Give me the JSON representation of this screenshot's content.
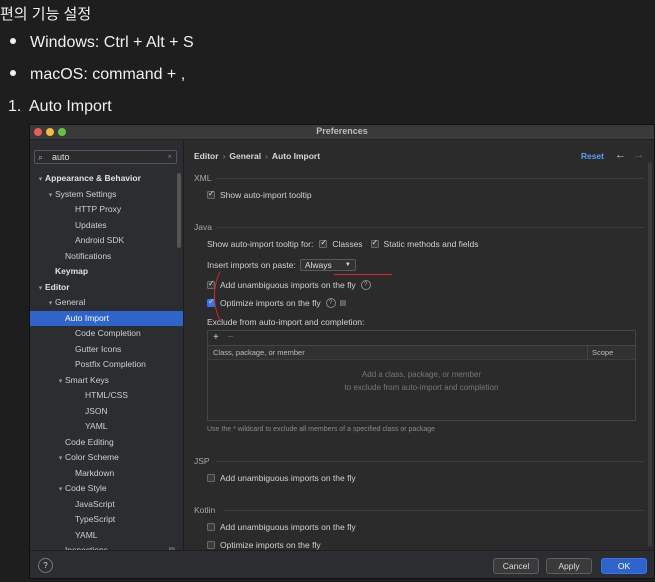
{
  "doc": {
    "heading": "편의 기능 설정",
    "bullets": [
      "Windows: Ctrl + Alt + S",
      "macOS: command + ,"
    ],
    "numbered": {
      "num": "1.",
      "text": "Auto Import"
    }
  },
  "window": {
    "title": "Preferences",
    "search": {
      "value": "auto",
      "icon": "search-icon",
      "clear": "×"
    },
    "tree": [
      {
        "label": "Appearance & Behavior",
        "arrow": "▾",
        "bold": true
      },
      {
        "label": "System Settings",
        "arrow": "▾"
      },
      {
        "label": "HTTP Proxy"
      },
      {
        "label": "Updates"
      },
      {
        "label": "Android SDK"
      },
      {
        "label": "Notifications"
      },
      {
        "label": "Keymap",
        "bold": true
      },
      {
        "label": "Editor",
        "arrow": "▾",
        "bold": true
      },
      {
        "label": "General",
        "arrow": "▾"
      },
      {
        "label": "Auto Import",
        "selected": true
      },
      {
        "label": "Code Completion"
      },
      {
        "label": "Gutter Icons"
      },
      {
        "label": "Postfix Completion"
      },
      {
        "label": "Smart Keys",
        "arrow": "▾"
      },
      {
        "label": "HTML/CSS"
      },
      {
        "label": "JSON"
      },
      {
        "label": "YAML"
      },
      {
        "label": "Code Editing"
      },
      {
        "label": "Color Scheme",
        "arrow": "▾"
      },
      {
        "label": "Markdown"
      },
      {
        "label": "Code Style",
        "arrow": "▾"
      },
      {
        "label": "JavaScript"
      },
      {
        "label": "TypeScript"
      },
      {
        "label": "YAML"
      },
      {
        "label": "Inspections"
      }
    ],
    "breadcrumb": [
      "Editor",
      "General",
      "Auto Import"
    ],
    "reset": "Reset",
    "back_arrow": "←",
    "forward_arrow": "→",
    "xml": {
      "title": "XML",
      "show_tooltip": "Show auto-import tooltip"
    },
    "java": {
      "title": "Java",
      "show_tooltip_for": "Show auto-import tooltip for:",
      "classes": "Classes",
      "static": "Static methods and fields",
      "insert_on_paste": "Insert imports on paste:",
      "paste_value": "Always",
      "add_unambiguous": "Add unambiguous imports on the fly",
      "optimize": "Optimize imports on the fly",
      "exclude_title": "Exclude from auto-import and completion:",
      "add_btn": "+",
      "remove_btn": "−",
      "col_class": "Class, package, or member",
      "col_scope": "Scope",
      "empty_line1": "Add a class, package, or member",
      "empty_line2": "to exclude from auto-import and completion",
      "footnote": "Use the * wildcard to exclude all members of a specified class or package"
    },
    "jsp": {
      "title": "JSP",
      "add_unambiguous": "Add unambiguous imports on the fly"
    },
    "kotlin": {
      "title": "Kotlin",
      "add_unambiguous": "Add unambiguous imports on the fly",
      "optimize": "Optimize imports on the fly"
    },
    "buttons": {
      "help": "?",
      "cancel": "Cancel",
      "apply": "Apply",
      "ok": "OK"
    },
    "colors": {
      "accent": "#2f65ca",
      "link": "#5a9cf5",
      "annotation": "#d42a2a"
    }
  }
}
